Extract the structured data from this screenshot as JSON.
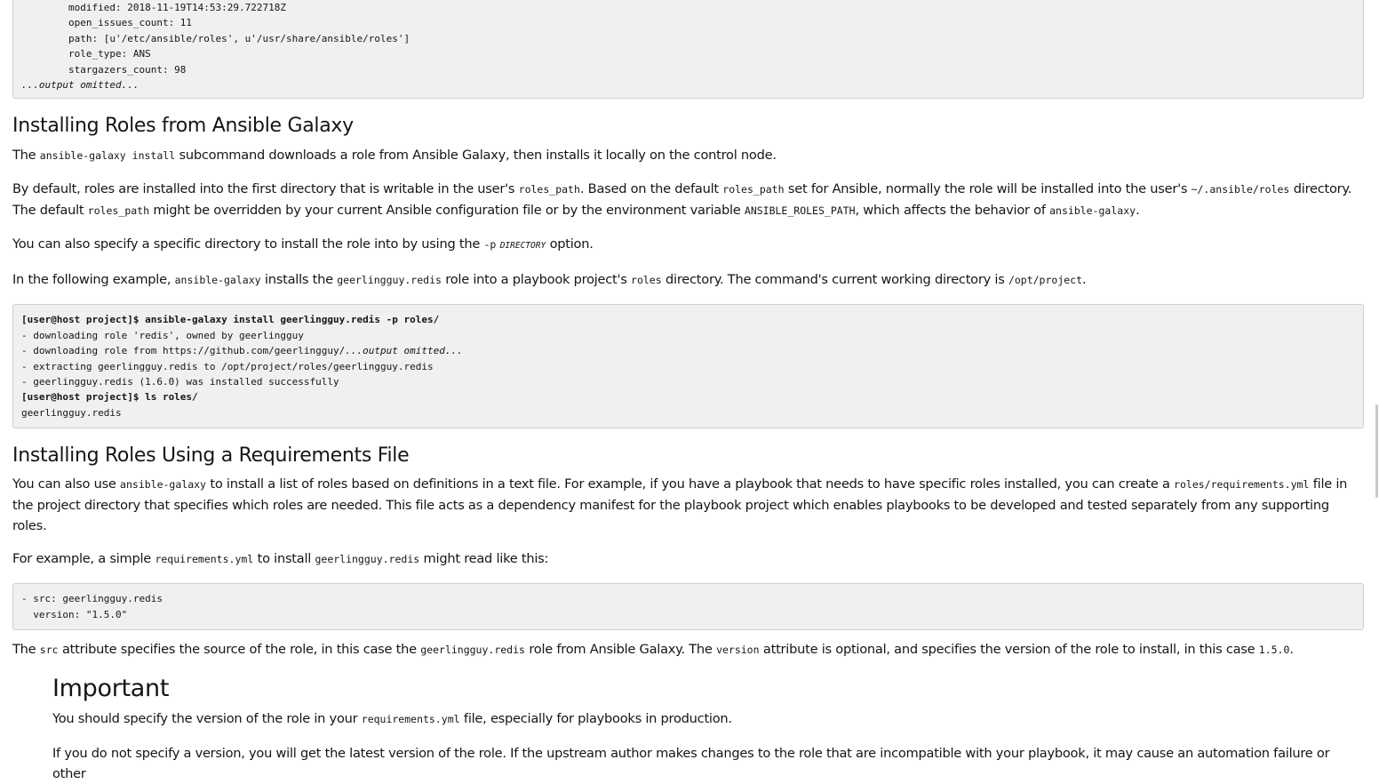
{
  "top_code": {
    "lines": [
      "        modified: 2018-11-19T14:53:29.722718Z",
      "        open_issues_count: 11",
      "        path: [u'/etc/ansible/roles', u'/usr/share/ansible/roles']",
      "        role_type: ANS",
      "        stargazers_count: 98"
    ],
    "omitted": "...output omitted..."
  },
  "section1": {
    "heading": "Installing Roles from Ansible Galaxy",
    "p1": {
      "t1": "The ",
      "c1": "ansible-galaxy install",
      "t2": " subcommand downloads a role from Ansible Galaxy, then installs it locally on the control node."
    },
    "p2": {
      "t1": "By default, roles are installed into the first directory that is writable in the user's ",
      "c1": "roles_path",
      "t2": ". Based on the default ",
      "c2": "roles_path",
      "t3": " set for Ansible, normally the role will be installed into the user's ",
      "c3": "~/.ansible/roles",
      "t4": " directory. The default ",
      "c4": "roles_path",
      "t5": " might be overridden by your current Ansible configuration file or by the environment variable ",
      "c5": "ANSIBLE_ROLES_PATH",
      "t6": ", which affects the behavior of ",
      "c6": "ansible-galaxy",
      "t7": "."
    },
    "p3": {
      "t1": "You can also specify a specific directory to install the role into by using the ",
      "c1": "-p",
      "c2": "DIRECTORY",
      "t2": " option."
    },
    "p4": {
      "t1": "In the following example, ",
      "c1": "ansible-galaxy",
      "t2": " installs the ",
      "c2": "geerlingguy.redis",
      "t3": " role into a playbook project's ",
      "c3": "roles",
      "t4": " directory. The command's current working directory is ",
      "c4": "/opt/project",
      "t5": "."
    },
    "code": {
      "cmd1": "[user@host project]$ ansible-galaxy install geerlingguy.redis -p roles/",
      "out1": "- downloading role 'redis', owned by geerlingguy",
      "out2": "- downloading role from https://github.com/geerlingguy/",
      "out2_em": "...output omitted...",
      "out3": "- extracting geerlingguy.redis to /opt/project/roles/geerlingguy.redis",
      "out4": "- geerlingguy.redis (1.6.0) was installed successfully",
      "cmd2": "[user@host project]$ ls roles/",
      "out5": "geerlingguy.redis"
    }
  },
  "section2": {
    "heading": "Installing Roles Using a Requirements File",
    "p1": {
      "t1": "You can also use ",
      "c1": "ansible-galaxy",
      "t2": " to install a list of roles based on definitions in a text file. For example, if you have a playbook that needs to have specific roles installed, you can create a ",
      "c2": "roles/requirements.yml",
      "t3": " file in the project directory that specifies which roles are needed. This file acts as a dependency manifest for the playbook project which enables playbooks to be developed and tested separately from any supporting roles."
    },
    "p2": {
      "t1": "For example, a simple ",
      "c1": "requirements.yml",
      "t2": " to install ",
      "c2": "geerlingguy.redis",
      "t3": " might read like this:"
    },
    "code": {
      "line1": "- src: geerlingguy.redis",
      "line2": "  version: \"1.5.0\""
    },
    "p3": {
      "t1": "The ",
      "c1": "src",
      "t2": " attribute specifies the source of the role, in this case the ",
      "c2": "geerlingguy.redis",
      "t3": " role from Ansible Galaxy. The ",
      "c3": "version",
      "t4": " attribute is optional, and specifies the version of the role to install, in this case ",
      "c4": "1.5.0",
      "t5": "."
    }
  },
  "important": {
    "heading": "Important",
    "p1": {
      "t1": "You should specify the version of the role in your ",
      "c1": "requirements.yml",
      "t2": " file, especially for playbooks in production."
    },
    "p2": {
      "t1": "If you do not specify a version, you will get the latest version of the role. If the upstream author makes changes to the role that are incompatible with your playbook, it may cause an automation failure or other"
    }
  }
}
